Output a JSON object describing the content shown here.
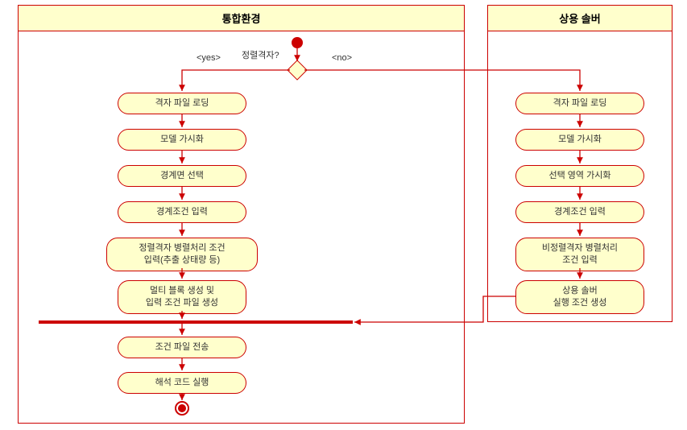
{
  "chart_data": {
    "type": "activity_diagram",
    "title": "",
    "swimlanes": [
      {
        "id": "integrated",
        "name": "통합환경"
      },
      {
        "id": "commercial",
        "name": "상용 솔버"
      }
    ],
    "start": {
      "swimlane": "integrated"
    },
    "decision": {
      "label": "정렬격자?",
      "yes_label": "<yes>",
      "no_label": "<no>",
      "yes_target": "a1",
      "no_target": "b1"
    },
    "activities_left": [
      {
        "id": "a1",
        "text": "격자 파일 로딩"
      },
      {
        "id": "a2",
        "text": "모델 가시화"
      },
      {
        "id": "a3",
        "text": "경계면 선택"
      },
      {
        "id": "a4",
        "text": "경계조건 입력"
      },
      {
        "id": "a5",
        "text": "정렬격자 병렬처리 조건\n입력(추출 상태량 등)"
      },
      {
        "id": "a6",
        "text": "멀티 블록 생성 및\n입력 조건 파일 생성"
      }
    ],
    "sync_bar": {
      "id": "join1",
      "swimlane": "integrated"
    },
    "activities_after_join": [
      {
        "id": "a7",
        "text": "조건 파일 전송"
      },
      {
        "id": "a8",
        "text": "해석 코드 실행"
      }
    ],
    "activities_right": [
      {
        "id": "b1",
        "text": "격자 파일 로딩"
      },
      {
        "id": "b2",
        "text": "모델 가시화"
      },
      {
        "id": "b3",
        "text": "선택 영역 가시화"
      },
      {
        "id": "b4",
        "text": "경계조건 입력"
      },
      {
        "id": "b5",
        "text": "비정렬격자 병렬처리\n조건 입력"
      },
      {
        "id": "b6",
        "text": "상용 솔버\n실행 조건 생성"
      }
    ],
    "edges": [
      {
        "from": "start",
        "to": "decision"
      },
      {
        "from": "decision",
        "to": "a1",
        "guard": "<yes>"
      },
      {
        "from": "decision",
        "to": "b1",
        "guard": "<no>"
      },
      {
        "from": "a1",
        "to": "a2"
      },
      {
        "from": "a2",
        "to": "a3"
      },
      {
        "from": "a3",
        "to": "a4"
      },
      {
        "from": "a4",
        "to": "a5"
      },
      {
        "from": "a5",
        "to": "a6"
      },
      {
        "from": "a6",
        "to": "join1"
      },
      {
        "from": "b1",
        "to": "b2"
      },
      {
        "from": "b2",
        "to": "b3"
      },
      {
        "from": "b3",
        "to": "b4"
      },
      {
        "from": "b4",
        "to": "b5"
      },
      {
        "from": "b5",
        "to": "b6"
      },
      {
        "from": "b6",
        "to": "join1"
      },
      {
        "from": "join1",
        "to": "a7"
      },
      {
        "from": "a7",
        "to": "a8"
      },
      {
        "from": "a8",
        "to": "end"
      }
    ],
    "end": {
      "swimlane": "integrated"
    }
  },
  "lane1_title": "통합환경",
  "lane2_title": "상용 솔버",
  "decision_label": "정렬격자?",
  "yes_label": "<yes>",
  "no_label": "<no>",
  "left": {
    "a1": "격자 파일 로딩",
    "a2": "모델 가시화",
    "a3": "경계면 선택",
    "a4": "경계조건 입력",
    "a5_l1": "정렬격자 병렬처리 조건",
    "a5_l2": "입력(추출 상태량 등)",
    "a6_l1": "멀티 블록 생성 및",
    "a6_l2": "입력 조건 파일 생성",
    "a7": "조건 파일 전송",
    "a8": "해석 코드 실행"
  },
  "right": {
    "b1": "격자 파일 로딩",
    "b2": "모델 가시화",
    "b3": "선택 영역 가시화",
    "b4": "경계조건 입력",
    "b5_l1": "비정렬격자 병렬처리",
    "b5_l2": "조건 입력",
    "b6_l1": "상용 솔버",
    "b6_l2": "실행 조건 생성"
  }
}
